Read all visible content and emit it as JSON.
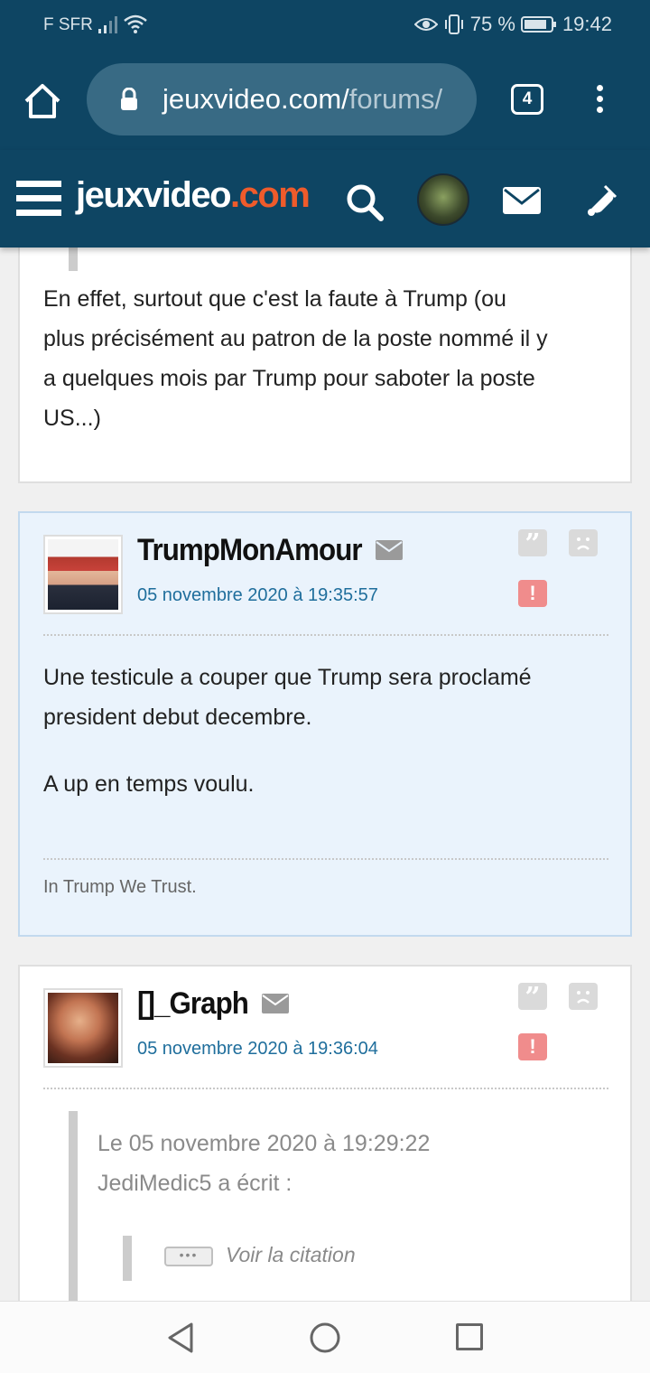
{
  "status_bar": {
    "carrier": "F SFR",
    "battery": "75 %",
    "time": "19:42"
  },
  "browser": {
    "url_main": "jeuxvideo.com/",
    "url_dim": "forums/",
    "tab_count": "4"
  },
  "site": {
    "logo_main": "jeuxvideo",
    "logo_suffix": ".com"
  },
  "posts": [
    {
      "body": [
        "En effet, surtout que c'est la faute à Trump (ou",
        "plus précisément au patron de la poste nommé il y",
        "a quelques mois par Trump pour saboter la poste",
        "US...)"
      ]
    },
    {
      "author": "TrumpMonAmour",
      "date": "05 novembre 2020 à 19:35:57",
      "body": [
        "Une testicule a couper que Trump sera proclamé",
        "president debut decembre.",
        "A up en temps voulu."
      ],
      "signature": "In Trump We Trust."
    },
    {
      "author": "[]_Graph",
      "date": "05 novembre 2020 à 19:36:04",
      "quote_header": [
        "Le 05 novembre 2020 à 19:29:22",
        "JediMedic5 a écrit :"
      ],
      "quote_toggle": "Voir la citation"
    }
  ],
  "icons": {
    "quote": "quote-icon",
    "sad": "sad-face-icon",
    "alert": "alert-icon",
    "mail": "mail-icon"
  },
  "colors": {
    "header": "#0e4563",
    "logo_accent": "#ef5b2b",
    "date": "#1f6e9c",
    "highlight_bg": "#eaf3fc"
  }
}
